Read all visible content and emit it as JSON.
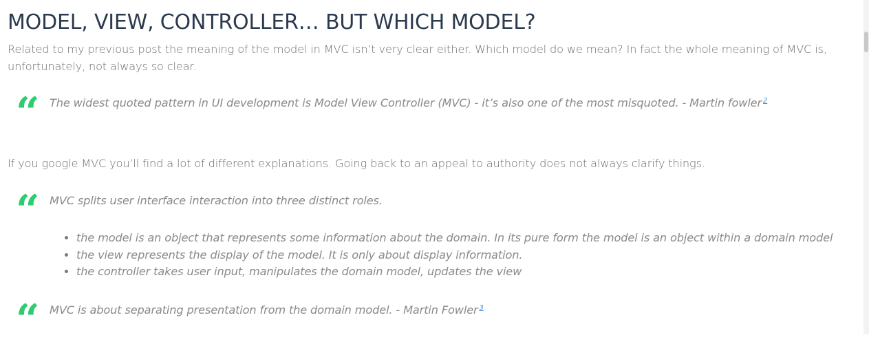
{
  "article": {
    "title": "MODEL, VIEW, CONTROLLER… BUT WHICH MODEL?",
    "intro": "Related to my previous post the meaning of the model in MVC isn’t very clear either. Which model do we mean? In fact the whole meaning of MVC is, unfortunately, not always so clear.",
    "quote1": {
      "mark": "“",
      "text": "The widest quoted pattern in UI development is Model View Controller (MVC) - it’s also one of the most misquoted. - Martin fowler",
      "footnote": "2"
    },
    "paragraph2": "If you google MVC you’ll find a lot of different explanations. Going back to an appeal to authority does not always clarify things.",
    "quote2": {
      "mark": "“",
      "text": "MVC splits user interface interaction into three distinct roles.",
      "items": [
        "the model is an object that represents some information about the domain. In its pure form the model is an object within a domain model",
        "the view represents the display of the model. It is only about display information.",
        "the controller takes user input, manipulates the domain model, updates the view"
      ]
    },
    "quote3": {
      "mark": "“",
      "text": "MVC is about separating presentation from the domain model. - Martin Fowler",
      "footnote": "3"
    }
  },
  "colors": {
    "title": "#2b3a4e",
    "body_text": "#6b6b6b",
    "quote_text": "#8a8a8a",
    "quote_mark": "#2ecc71",
    "link": "#3b8fd9"
  }
}
